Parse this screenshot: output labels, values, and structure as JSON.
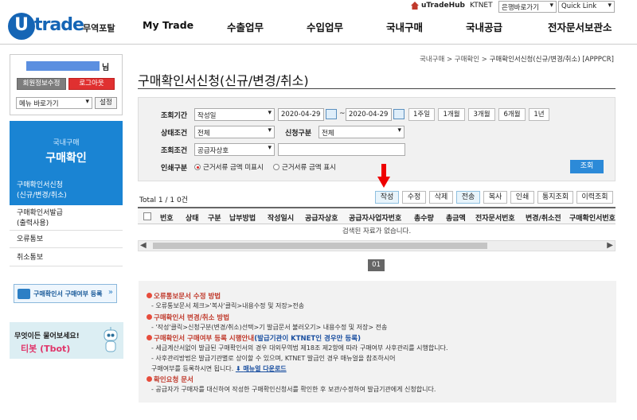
{
  "header": {
    "logo_letter": "U",
    "logo_text": "trade",
    "logo_sub": "무역포탈",
    "nav": [
      "My Trade",
      "수출업무",
      "수입업무",
      "국내구매",
      "국내공급",
      "전자문서보관소"
    ],
    "top_links": {
      "hub": "uTradeHub",
      "ktnet": "KTNET"
    },
    "bank_select": "은행바로가기",
    "quick_link": "Quick Link"
  },
  "user": {
    "suffix": "님",
    "edit_button": "회원정보수정",
    "logout_button": "로그아웃",
    "menu_select": "메뉴 바로가기",
    "settings_button": "설정"
  },
  "sidebar": {
    "section_sub": "국내구매",
    "section_title": "구매확인",
    "items": [
      {
        "line1": "구매확인서신청",
        "line2": "(신규/변경/취소)"
      },
      {
        "line1": "구매확인서발급",
        "line2": "(출력사용)"
      },
      {
        "line1": "오류통보",
        "line2": ""
      },
      {
        "line1": "취소통보",
        "line2": ""
      }
    ],
    "banner1": "구매확인서 구매여부 등록",
    "banner2_line1": "무엇이든 물어보세요!",
    "banner2_line2": "티봇 (Tbot)"
  },
  "breadcrumb": {
    "a": "국내구매",
    "b": "구매확인",
    "c": "구매확인서신청(신규/변경/취소) [APPPCR]"
  },
  "page_title": "구매확인서신청(신규/변경/취소)",
  "search": {
    "period_label": "조회기간",
    "period_type": "작성일",
    "date_from": "2020-04-29",
    "tilde": "~",
    "date_to": "2020-04-29",
    "period_buttons": [
      "1주일",
      "1개월",
      "3개월",
      "6개월",
      "1년"
    ],
    "status_label": "상태조건",
    "status_value": "전체",
    "apply_type_label": "신청구분",
    "apply_type_value": "전체",
    "cond_label": "조회조건",
    "cond_value": "공급자상호",
    "print_label": "인쇄구분",
    "print_opt1": "근거서류 금액 미표시",
    "print_opt2": "근거서류 금액 표시",
    "search_button": "조회"
  },
  "actions": {
    "total": "Total 1 / 1 0건",
    "buttons": [
      "작성",
      "수정",
      "삭제",
      "전송",
      "복사",
      "인쇄",
      "통지조회",
      "이력조회"
    ]
  },
  "table": {
    "columns": [
      "번호",
      "상태",
      "구분",
      "납부방법",
      "작성일시",
      "공급자상호",
      "공급자사업자번호",
      "총수량",
      "총금액",
      "전자문서번호",
      "변경/취소전",
      "구매확인서번호"
    ],
    "empty_message": "검색된 자료가 없습니다."
  },
  "pagination": {
    "current": "01"
  },
  "notice": {
    "h1": "오류통보문서 수정 방법",
    "l1": "- 오류통보문서 체크>'복사'클릭>내용수정 및 저장>전송",
    "h2": "구매확인서 변경/취소 방법",
    "l2": "- '작성'클릭>신청구분(변경/취소)선택>기 발급문서 불러오기> 내용수정 및 저장> 전송",
    "h3a": "구매확인서 구매여부 등록 시행안내",
    "h3b": "(발급기관이 KTNET인 경우만 등록)",
    "l3": "- 세금계산서없이 발급된 구매확인서의 경우 대외무역법 제18조 제2항에 따라 구매여부 사후관리를 시행합니다.",
    "l4": "- 사후관리방법은 발급기관별로 상이할 수 있으며, KTNET 발급인 경우 매뉴얼을 참조하시어",
    "l5a": "구매여부를 등록하시면 됩니다.",
    "l5b": "매뉴얼 다운로드",
    "h4": "확인요청 문서",
    "l6": "- 공급자가 구매자를 대신하여 작성한 구매확인신청서를 확인한 후 보관/수정하여 발급기관에게 신청합니다."
  }
}
